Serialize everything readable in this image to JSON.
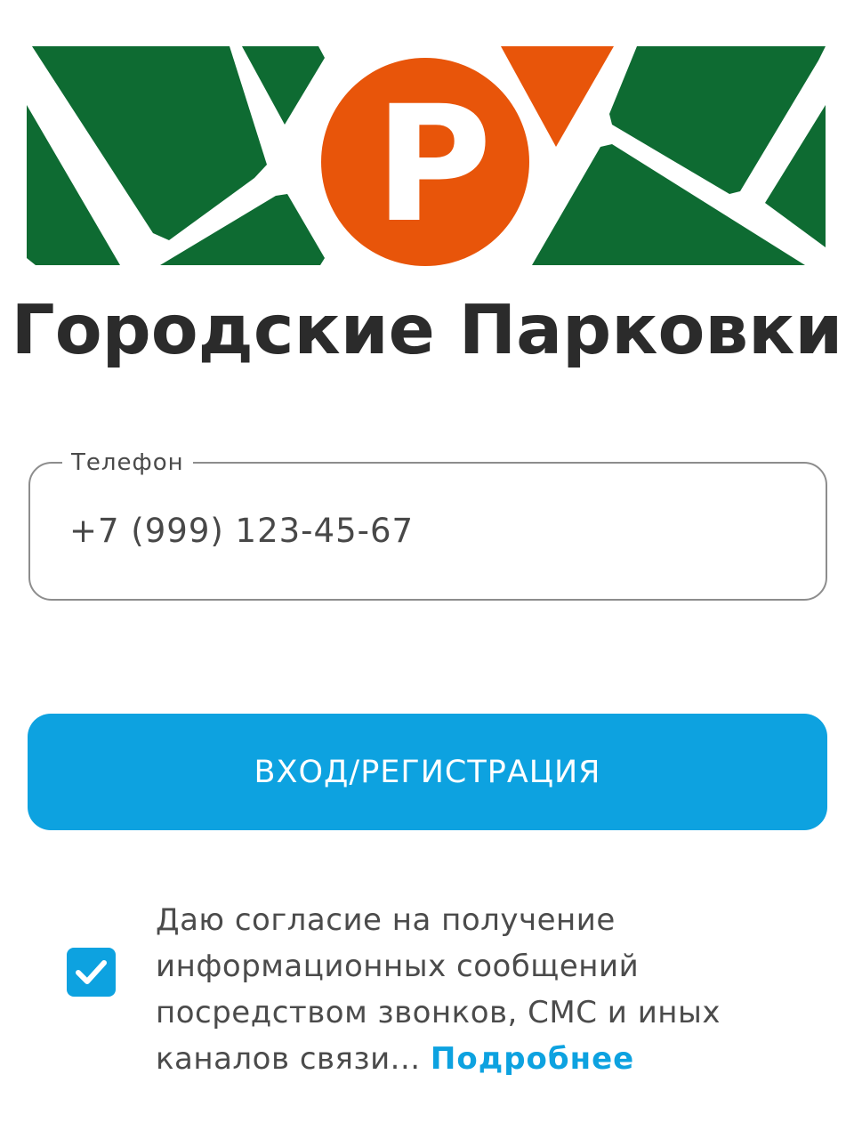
{
  "brand": {
    "name": "Городские Парковки",
    "logo_letter": "P",
    "colors": {
      "green": "#0e6b32",
      "orange": "#e8550a",
      "text": "#2b2b2b"
    }
  },
  "phone_field": {
    "label": "Телефон",
    "value": "+7 (999) 123-45-67"
  },
  "login_button": {
    "label": "ВХОД/РЕГИСТРАЦИЯ",
    "color": "#0da2e0"
  },
  "consent": {
    "checked": true,
    "lines": [
      "Даю согласие на получение",
      "информационных сообщений",
      "посредством звонков, СМС и иных",
      "каналов связи..."
    ],
    "more_link": "Подробнее",
    "icon": "check-icon"
  }
}
